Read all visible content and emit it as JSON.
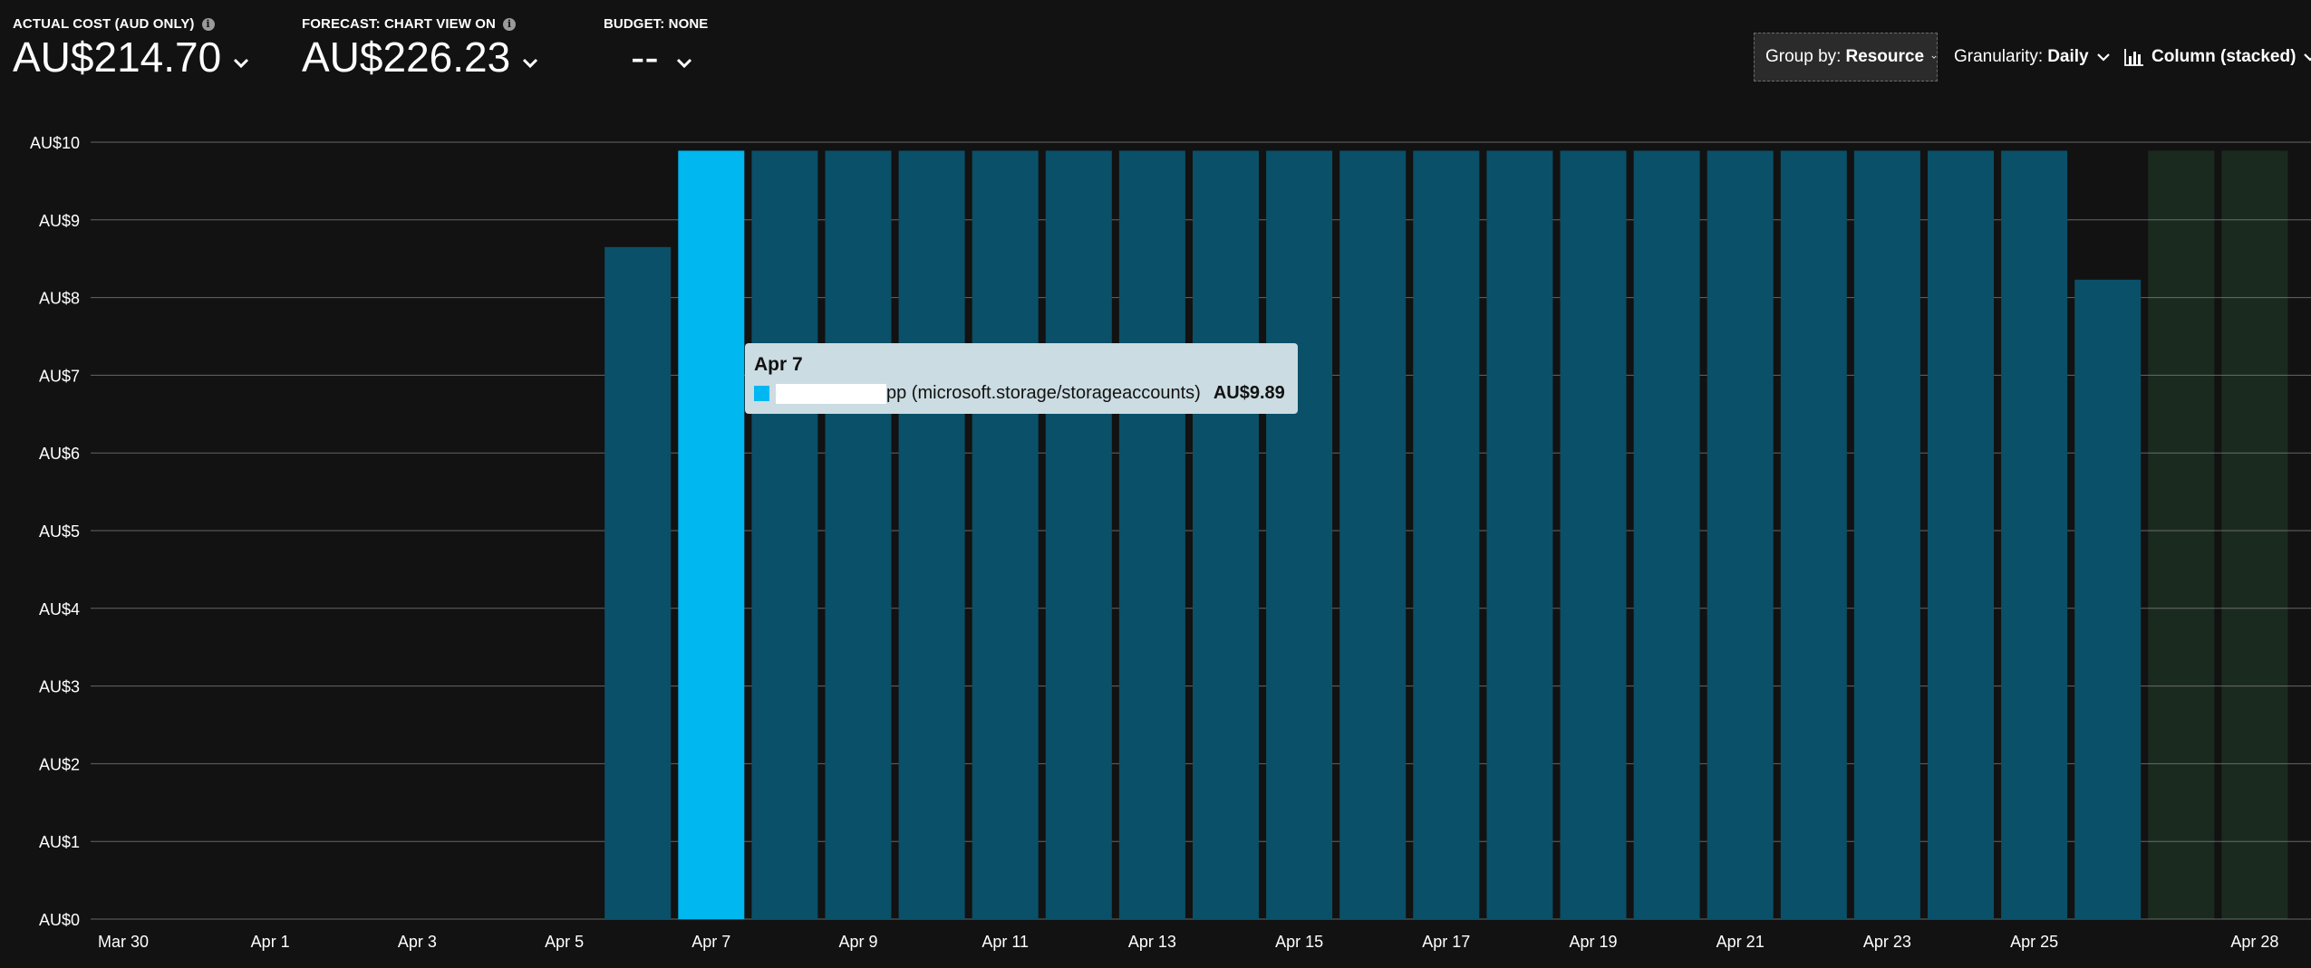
{
  "kpis": [
    {
      "label": "ACTUAL COST (AUD ONLY)",
      "value": "AU$214.70",
      "info": true
    },
    {
      "label": "FORECAST: CHART VIEW ON",
      "value": "AU$226.23",
      "info": true
    },
    {
      "label": "BUDGET: NONE",
      "value": "--",
      "info": false
    }
  ],
  "toolbar": {
    "group_by_label": "Group by:",
    "group_by_value": "Resource",
    "granularity_label": "Granularity:",
    "granularity_value": "Daily",
    "view_value": "Column (stacked)"
  },
  "tooltip": {
    "date": "Apr 7",
    "series_suffix": "pp (microsoft.storage/storageaccounts)",
    "value": "AU$9.89"
  },
  "colors": {
    "background": "#121212",
    "bar": "#0a5068",
    "bar_highlight": "#00b7f0",
    "forecast_band": "#1b2a1f",
    "grid": "#8a8a8a"
  },
  "chart_data": {
    "type": "bar",
    "stacked": true,
    "ylim": [
      0,
      10
    ],
    "yticks": [
      "AU$0",
      "AU$1",
      "AU$2",
      "AU$3",
      "AU$4",
      "AU$5",
      "AU$6",
      "AU$7",
      "AU$8",
      "AU$9",
      "AU$10"
    ],
    "categories": [
      "Mar 30",
      "Mar 31",
      "Apr 1",
      "Apr 2",
      "Apr 3",
      "Apr 4",
      "Apr 5",
      "Apr 6",
      "Apr 7",
      "Apr 8",
      "Apr 9",
      "Apr 10",
      "Apr 11",
      "Apr 12",
      "Apr 13",
      "Apr 14",
      "Apr 15",
      "Apr 16",
      "Apr 17",
      "Apr 18",
      "Apr 19",
      "Apr 20",
      "Apr 21",
      "Apr 22",
      "Apr 23",
      "Apr 24",
      "Apr 25",
      "Apr 26",
      "Apr 27",
      "Apr 28"
    ],
    "xtick_labels": [
      "Mar 30",
      "Apr 1",
      "Apr 3",
      "Apr 5",
      "Apr 7",
      "Apr 9",
      "Apr 11",
      "Apr 13",
      "Apr 15",
      "Apr 17",
      "Apr 19",
      "Apr 21",
      "Apr 23",
      "Apr 25",
      "Apr 28"
    ],
    "values": [
      0,
      0,
      0,
      0,
      0,
      0,
      0,
      8.65,
      9.89,
      9.89,
      9.89,
      9.89,
      9.89,
      9.89,
      9.89,
      9.89,
      9.89,
      9.89,
      9.89,
      9.89,
      9.89,
      9.89,
      9.89,
      9.89,
      9.89,
      9.89,
      9.89,
      8.23,
      0,
      0
    ],
    "forecast_categories": [
      "Apr 27",
      "Apr 28"
    ],
    "forecast_values": [
      9.89,
      9.89
    ],
    "highlighted": "Apr 7"
  }
}
